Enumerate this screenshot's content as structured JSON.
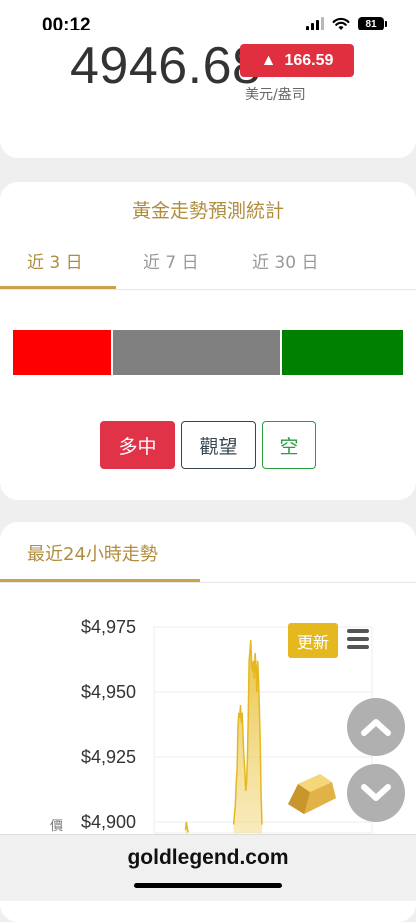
{
  "status_bar": {
    "time": "00:12",
    "battery": "81"
  },
  "price": {
    "value": "4946.68",
    "change": "166.59",
    "change_arrow": "▲",
    "unit": "美元/盎司",
    "colors": {
      "up": "#e03040"
    }
  },
  "forecast": {
    "title": "黃金走勢預測統計",
    "tabs": [
      {
        "label": "近 3 日",
        "active": true
      },
      {
        "label": "近 7 日",
        "active": false
      },
      {
        "label": "近 30 日",
        "active": false
      }
    ],
    "distribution": [
      {
        "name": "多中",
        "share": 0.25,
        "color": "#ff0000"
      },
      {
        "name": "觀望",
        "share": 0.43,
        "color": "#808080"
      },
      {
        "name": "空",
        "share": 0.31,
        "color": "#008000"
      }
    ],
    "buttons": {
      "long": "多中",
      "wait": "觀望",
      "short": "空"
    }
  },
  "trend": {
    "title": "最近24小時走勢",
    "refresh_label": "更新",
    "axis_fragment": "價"
  },
  "chart_data": {
    "type": "area",
    "title": "",
    "xlabel": "",
    "ylabel": "",
    "color": "#e6b820",
    "y_tick_labels": [
      "$4,975",
      "$4,950",
      "$4,925",
      "$4,900"
    ],
    "y_ticks": [
      4975,
      4950,
      4925,
      4900
    ],
    "ylim_visible": [
      4894,
      4979
    ],
    "x": [
      0,
      1,
      2,
      3,
      4,
      5,
      6,
      7,
      8,
      9,
      10,
      11,
      12,
      13,
      14,
      15,
      16,
      17,
      18,
      19,
      20,
      21,
      22,
      23,
      24,
      25,
      26,
      27,
      28,
      29,
      30,
      31,
      32,
      33,
      34,
      35,
      36,
      37,
      38,
      39,
      40,
      41,
      42,
      43,
      44,
      45,
      46,
      47,
      48,
      49,
      50,
      51,
      52,
      53,
      54,
      55,
      56,
      57,
      58,
      59,
      60,
      61,
      62,
      63,
      64,
      65,
      66,
      67,
      68,
      69,
      70,
      71,
      72,
      73,
      74,
      75,
      76,
      77,
      78,
      79,
      80,
      81,
      82,
      83,
      84,
      85,
      86,
      87,
      88,
      89,
      90,
      91,
      92,
      93,
      94,
      95,
      96,
      97,
      98,
      99,
      100,
      101,
      102,
      103,
      104,
      105,
      106,
      107
    ],
    "values": [
      null,
      null,
      null,
      null,
      null,
      null,
      null,
      null,
      null,
      null,
      null,
      null,
      null,
      null,
      null,
      null,
      null,
      null,
      4897,
      4900,
      4898,
      4896,
      null,
      null,
      null,
      null,
      null,
      null,
      null,
      null,
      null,
      null,
      null,
      null,
      null,
      null,
      null,
      null,
      null,
      null,
      null,
      null,
      null,
      null,
      null,
      null,
      null,
      null,
      null,
      null,
      null,
      null,
      null,
      null,
      null,
      null,
      null,
      null,
      null,
      null,
      null,
      null,
      null,
      null,
      null,
      null,
      null,
      null,
      null,
      null,
      null,
      null,
      null,
      null,
      4899,
      4903,
      4906,
      4915,
      4920,
      4936,
      4942,
      4940,
      4945,
      4938,
      4942,
      4932,
      4925,
      4920,
      4912,
      4915,
      4924,
      4940,
      4962,
      4966,
      4970,
      4960,
      4958,
      4962,
      4955,
      4965,
      4960,
      4950,
      4962,
      4954,
      4943,
      4930,
      4910,
      4899
    ]
  },
  "footer": {
    "domain": "goldlegend.com"
  }
}
